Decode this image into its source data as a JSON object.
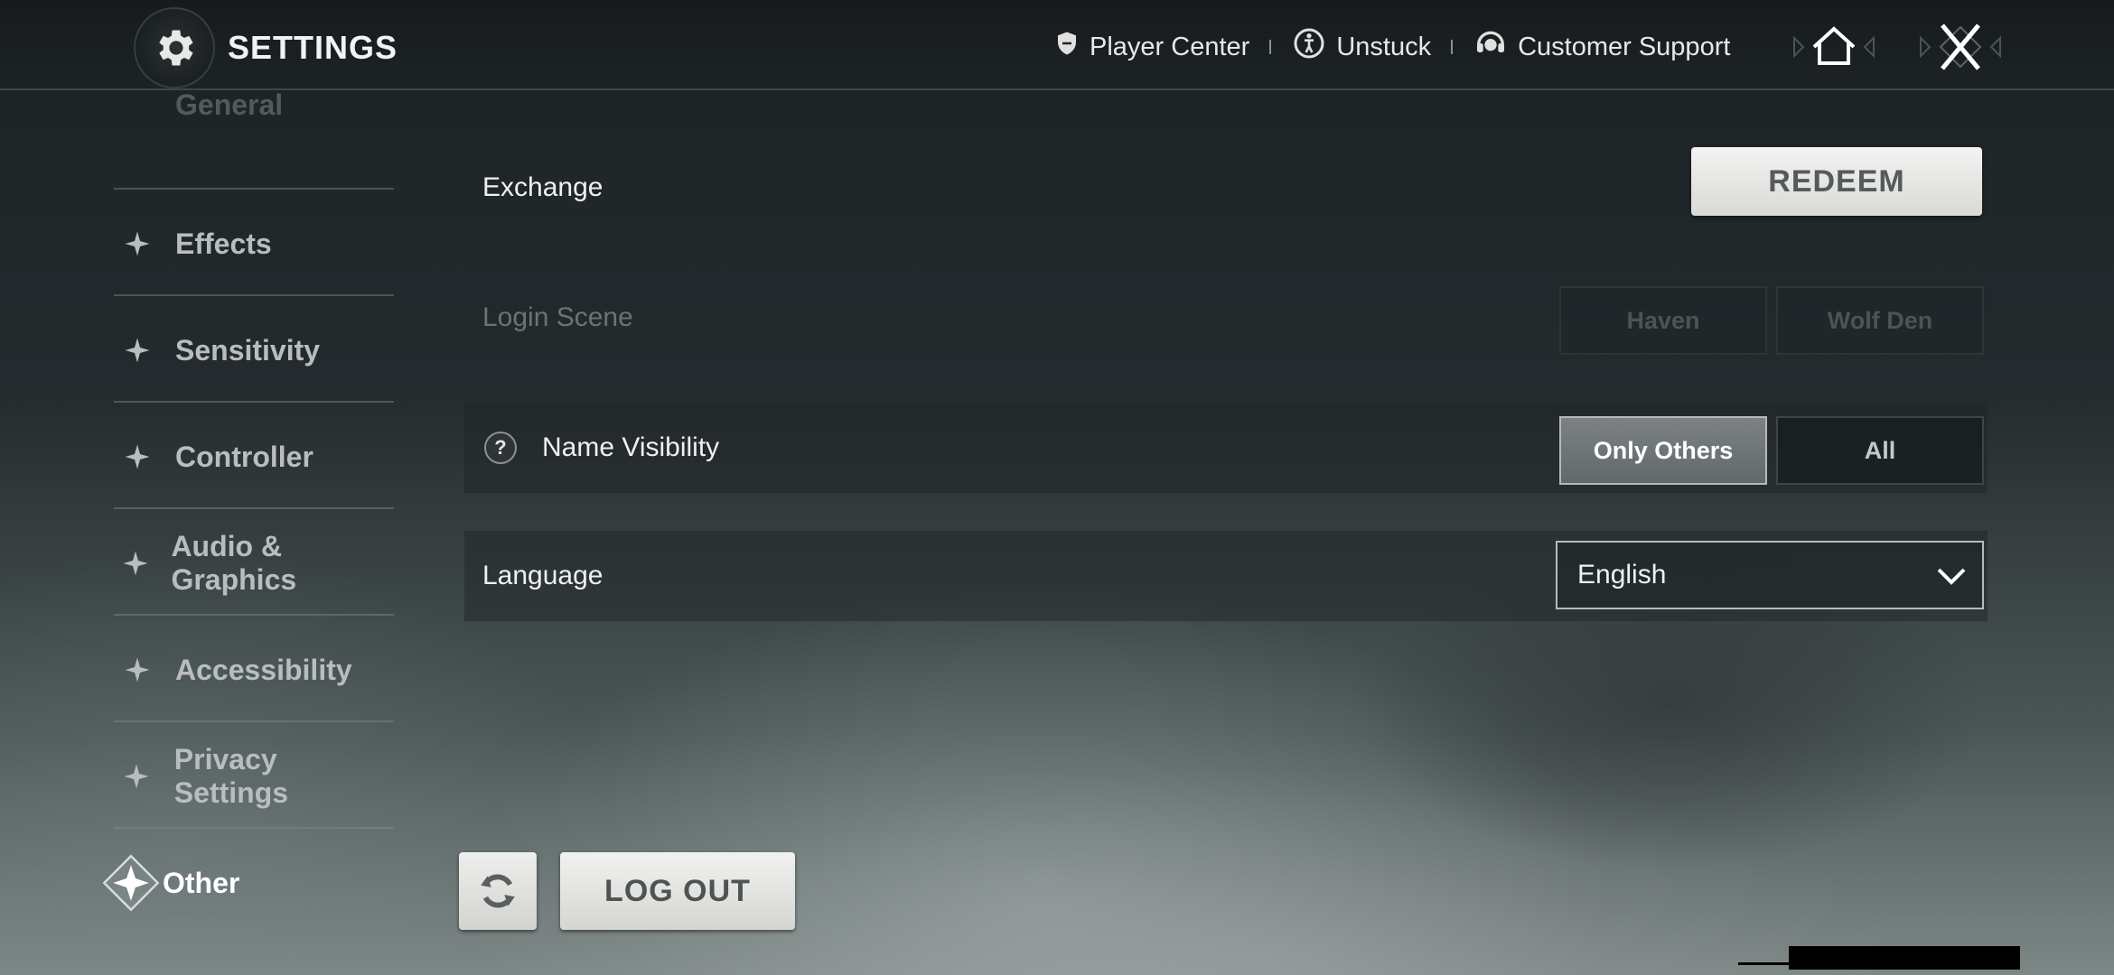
{
  "header": {
    "title": "SETTINGS",
    "links": [
      {
        "label": "Player Center",
        "icon": "shield-icon"
      },
      {
        "label": "Unstuck",
        "icon": "unstuck-icon"
      },
      {
        "label": "Customer Support",
        "icon": "headset-icon"
      }
    ]
  },
  "sidebar": {
    "items": [
      {
        "label": "General"
      },
      {
        "label": "Effects"
      },
      {
        "label": "Sensitivity"
      },
      {
        "label": "Controller"
      },
      {
        "label": "Audio & Graphics"
      },
      {
        "label": "Accessibility"
      },
      {
        "label": "Privacy Settings"
      },
      {
        "label": "Other"
      }
    ],
    "active": "Other"
  },
  "settings": {
    "exchange": {
      "label": "Exchange",
      "button": "REDEEM"
    },
    "login_scene": {
      "label": "Login Scene",
      "options": [
        "Haven",
        "Wolf Den"
      ]
    },
    "name_visibility": {
      "label": "Name Visibility",
      "help": "?",
      "options": [
        "Only Others",
        "All"
      ],
      "selected": "Only Others"
    },
    "language": {
      "label": "Language",
      "value": "English"
    }
  },
  "footer": {
    "logout": "LOG OUT"
  },
  "colors": {
    "accent_button": "#e6e7e3",
    "selected_segment": "#6f7576"
  }
}
